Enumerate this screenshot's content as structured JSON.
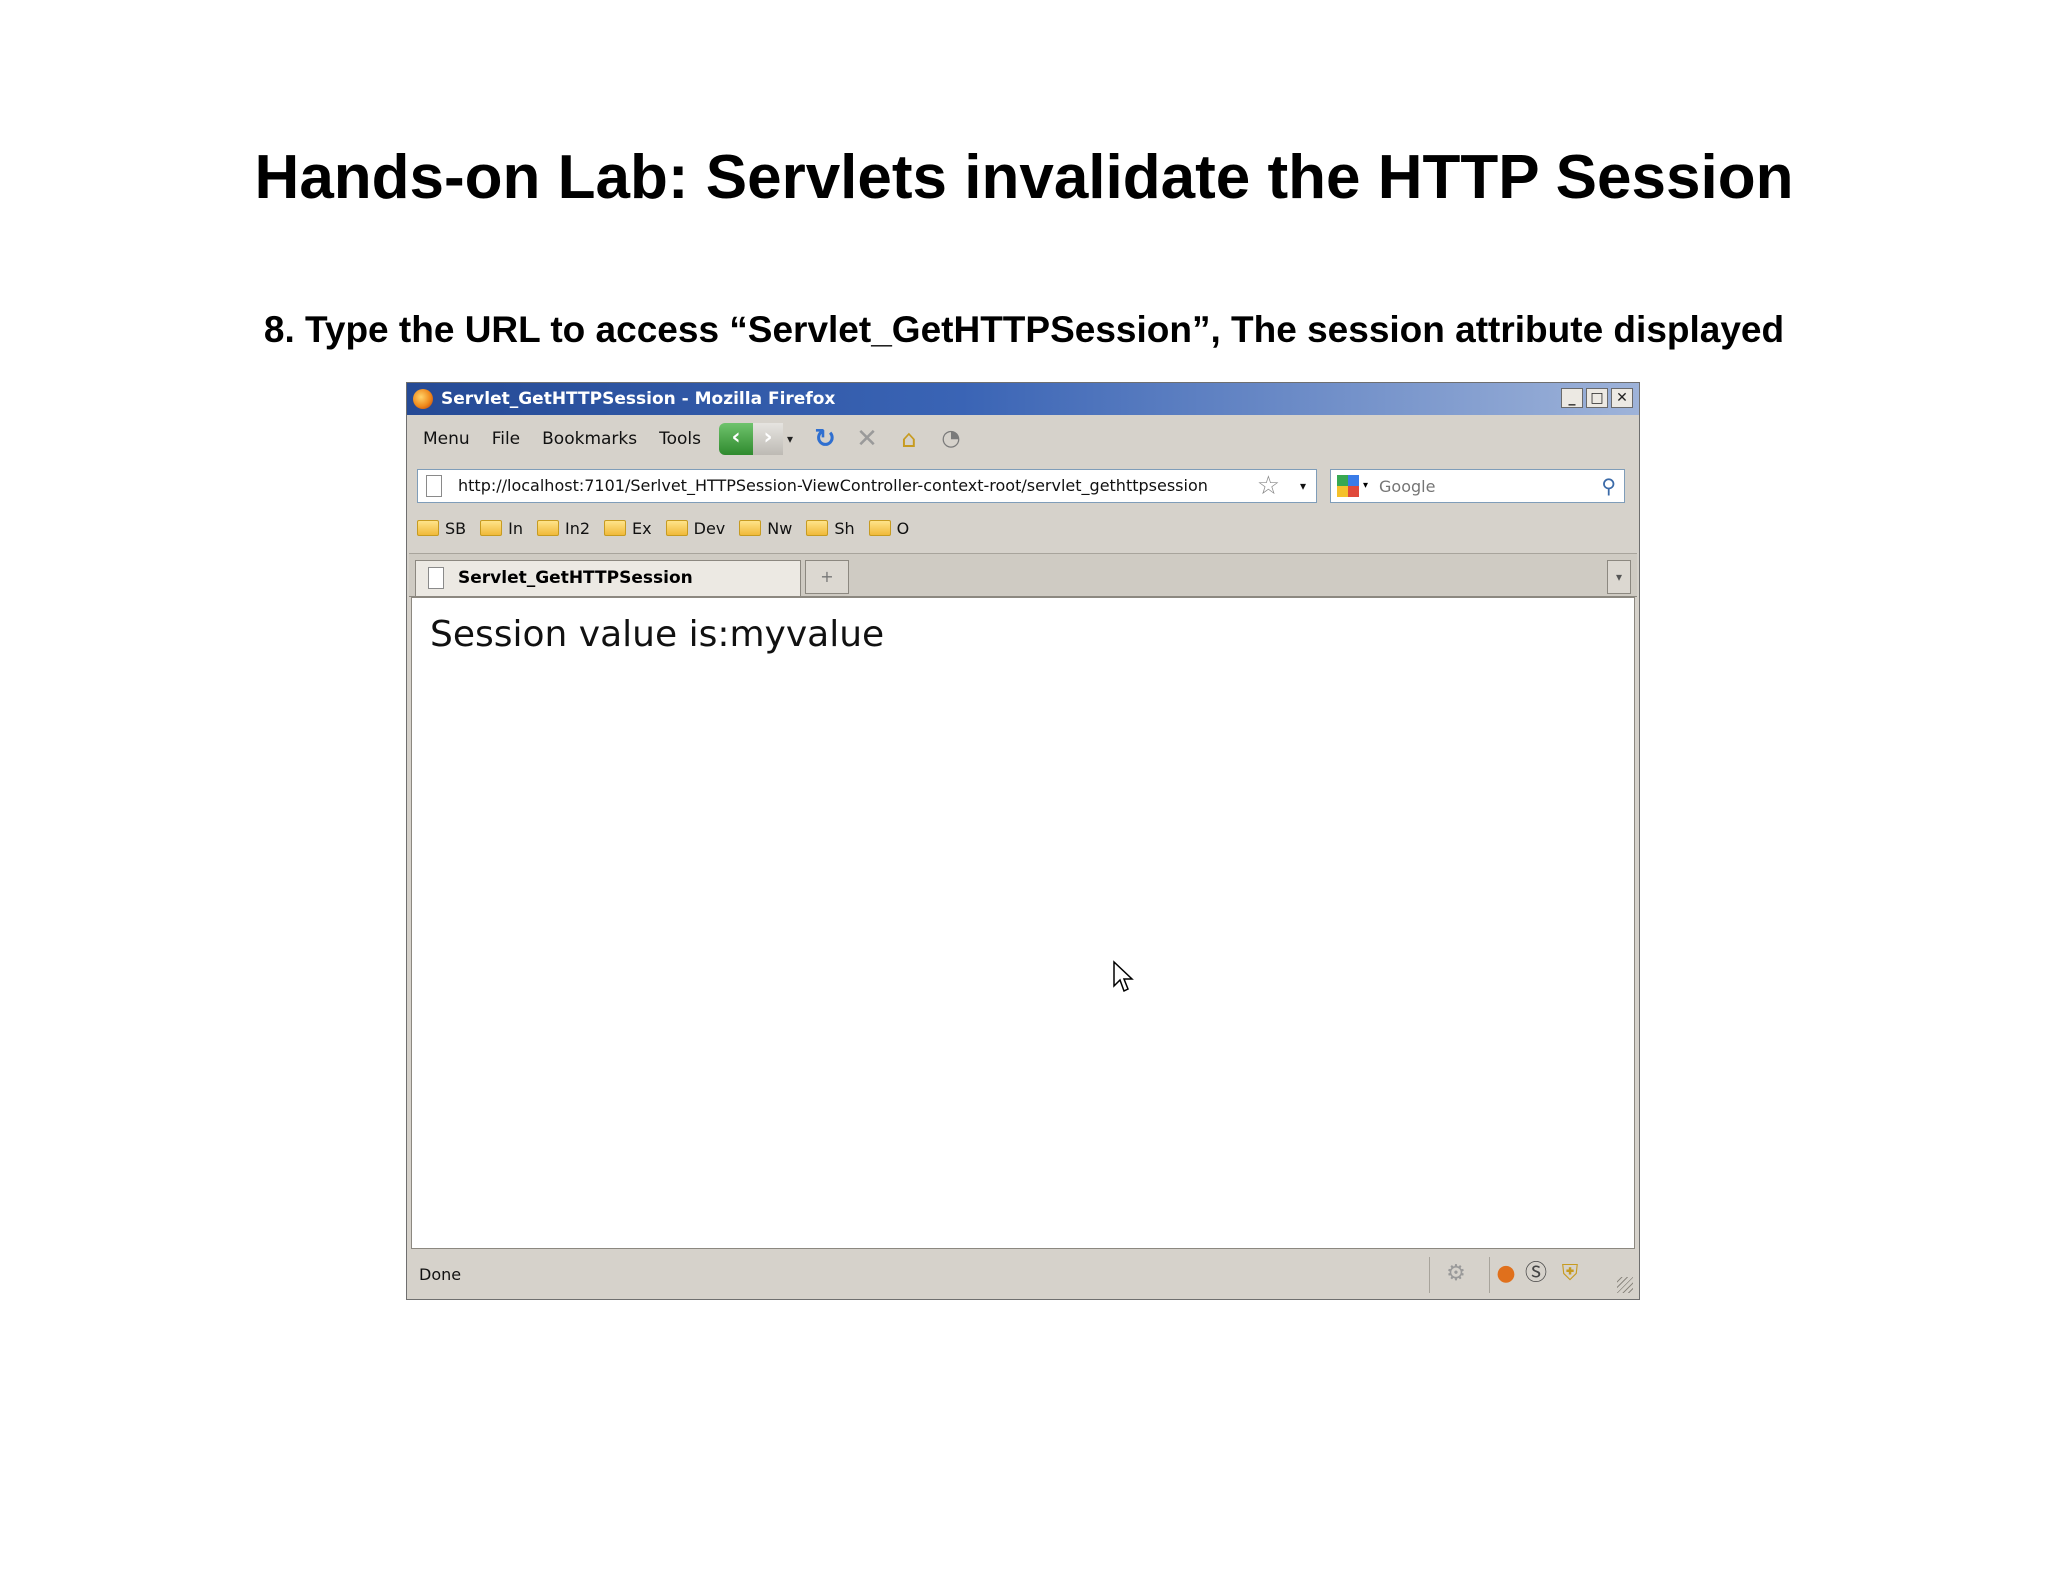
{
  "slide": {
    "title": "Hands-on Lab: Servlets invalidate the HTTP Session",
    "subtitle": "8. Type the URL to access “Servlet_GetHTTPSession”, The session attribute displayed"
  },
  "window": {
    "title": "Servlet_GetHTTPSession - Mozilla Firefox",
    "controls": {
      "minimize": "_",
      "maximize": "□",
      "close": "✕"
    }
  },
  "menu": {
    "items": [
      "Menu",
      "File",
      "Bookmarks",
      "Tools"
    ]
  },
  "toolbar": {
    "back": "‹",
    "forward": "›"
  },
  "address": {
    "url": "http://localhost:7101/Serlvet_HTTPSession-ViewController-context-root/servlet_gethttpsession"
  },
  "search": {
    "placeholder": "Google"
  },
  "bookmarks": {
    "items": [
      "SB",
      "In",
      "In2",
      "Ex",
      "Dev",
      "Nw",
      "Sh",
      "O"
    ]
  },
  "tab": {
    "label": "Servlet_GetHTTPSession"
  },
  "page": {
    "text": "Session value is:myvalue"
  },
  "status": {
    "text": "Done"
  },
  "icons": {
    "reload": "reload-icon",
    "stop": "stop-icon",
    "home": "home-icon",
    "search": "magnify-icon",
    "bookmark_star": "star-icon"
  },
  "colors": {
    "titlebar": "#254a95",
    "back_button": "#2f8a2e",
    "chrome": "#d6d2cb"
  }
}
